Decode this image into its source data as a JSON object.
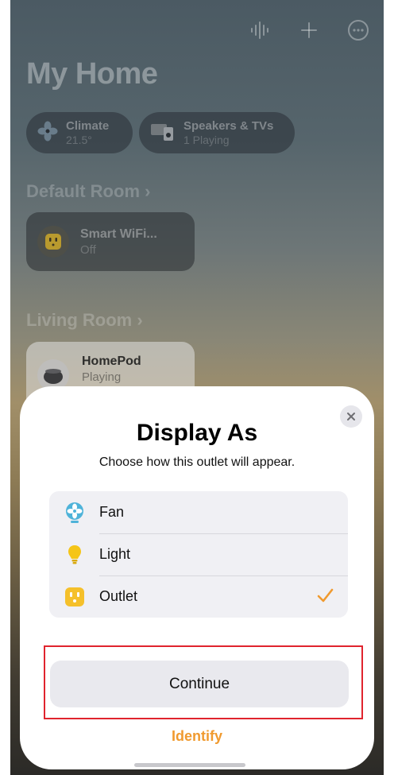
{
  "header": {
    "title": "My Home",
    "icons": [
      "waveform-icon",
      "plus-icon",
      "more-icon"
    ]
  },
  "status_chips": [
    {
      "title": "Climate",
      "subtitle": "21.5°",
      "icon": "fan-icon"
    },
    {
      "title": "Speakers & TVs",
      "subtitle": "1 Playing",
      "icon": "speaker-icon"
    }
  ],
  "rooms": [
    {
      "name": "Default Room",
      "chevron": "›",
      "accessories": [
        {
          "name": "Smart WiFi...",
          "status": "Off",
          "icon": "outlet-icon"
        }
      ]
    },
    {
      "name": "Living Room",
      "chevron": "›",
      "accessories": [
        {
          "name": "HomePod",
          "status": "Playing",
          "icon": "homepod-icon"
        }
      ]
    }
  ],
  "modal": {
    "title": "Display As",
    "subtitle": "Choose how this outlet will appear.",
    "options": [
      {
        "label": "Fan",
        "icon": "fan-icon",
        "selected": false
      },
      {
        "label": "Light",
        "icon": "lightbulb-icon",
        "selected": false
      },
      {
        "label": "Outlet",
        "icon": "outlet-icon",
        "selected": true
      }
    ],
    "primary_button": "Continue",
    "secondary_link": "Identify"
  },
  "colors": {
    "accent": "#f09a2f",
    "fan": "#4fb3d9",
    "light": "#f5c518",
    "outlet": "#f5c02a",
    "highlight": "#e0242e"
  }
}
